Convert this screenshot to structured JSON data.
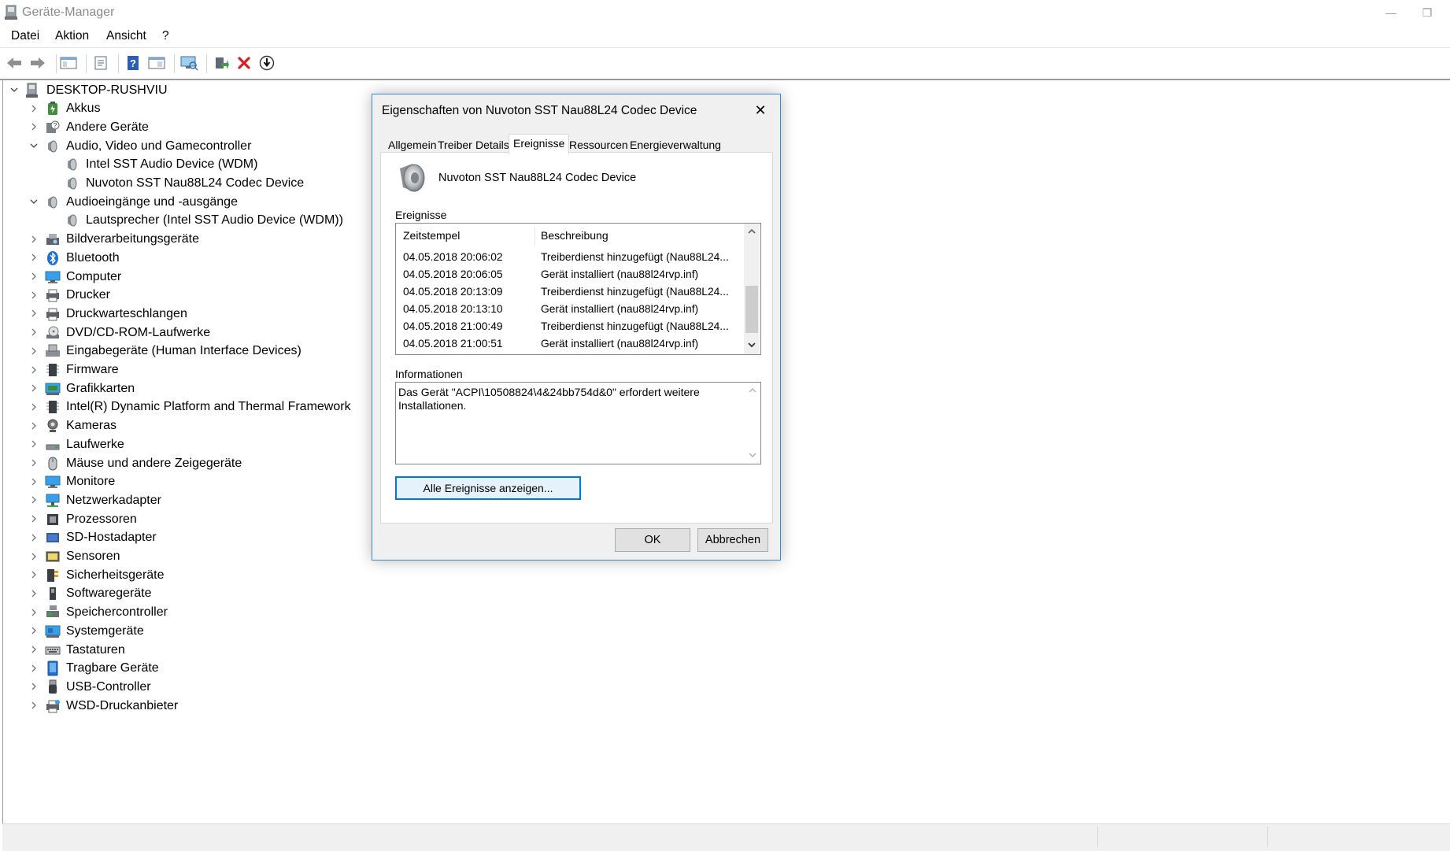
{
  "window": {
    "title": "Geräte-Manager",
    "minimize_glyph": "—",
    "restore_glyph": "❐"
  },
  "menu": [
    "Datei",
    "Aktion",
    "Ansicht",
    "?"
  ],
  "toolbar": {
    "icons": [
      "back-arrow-icon",
      "forward-arrow-icon",
      "show-hide-console-tree-icon",
      "properties-icon",
      "help-icon",
      "action-pane-icon",
      "scan-hardware-icon",
      "update-driver-icon",
      "uninstall-device-icon",
      "disable-device-icon"
    ]
  },
  "tree": {
    "root": "DESKTOP-RUSHVIU",
    "items": [
      {
        "label": "Akkus",
        "expanded": false
      },
      {
        "label": "Andere Geräte",
        "expanded": false
      },
      {
        "label": "Audio, Video und Gamecontroller",
        "expanded": true,
        "children": [
          "Intel SST Audio Device (WDM)",
          "Nuvoton SST Nau88L24 Codec Device"
        ]
      },
      {
        "label": "Audioeingänge und -ausgänge",
        "expanded": true,
        "children": [
          "Lautsprecher (Intel SST Audio Device (WDM))"
        ]
      },
      {
        "label": "Bildverarbeitungsgeräte",
        "expanded": false
      },
      {
        "label": "Bluetooth",
        "expanded": false
      },
      {
        "label": "Computer",
        "expanded": false
      },
      {
        "label": "Drucker",
        "expanded": false
      },
      {
        "label": "Druckwarteschlangen",
        "expanded": false
      },
      {
        "label": "DVD/CD-ROM-Laufwerke",
        "expanded": false
      },
      {
        "label": "Eingabegeräte (Human Interface Devices)",
        "expanded": false
      },
      {
        "label": "Firmware",
        "expanded": false
      },
      {
        "label": "Grafikkarten",
        "expanded": false
      },
      {
        "label": "Intel(R) Dynamic Platform and Thermal Framework",
        "expanded": false
      },
      {
        "label": "Kameras",
        "expanded": false
      },
      {
        "label": "Laufwerke",
        "expanded": false
      },
      {
        "label": "Mäuse und andere Zeigegeräte",
        "expanded": false
      },
      {
        "label": "Monitore",
        "expanded": false
      },
      {
        "label": "Netzwerkadapter",
        "expanded": false
      },
      {
        "label": "Prozessoren",
        "expanded": false
      },
      {
        "label": "SD-Hostadapter",
        "expanded": false
      },
      {
        "label": "Sensoren",
        "expanded": false
      },
      {
        "label": "Sicherheitsgeräte",
        "expanded": false
      },
      {
        "label": "Softwaregeräte",
        "expanded": false
      },
      {
        "label": "Speichercontroller",
        "expanded": false
      },
      {
        "label": "Systemgeräte",
        "expanded": false
      },
      {
        "label": "Tastaturen",
        "expanded": false
      },
      {
        "label": "Tragbare Geräte",
        "expanded": false
      },
      {
        "label": "USB-Controller",
        "expanded": false
      },
      {
        "label": "WSD-Druckanbieter",
        "expanded": false
      }
    ]
  },
  "dialog": {
    "title": "Eigenschaften von Nuvoton SST Nau88L24 Codec Device",
    "tabs": [
      "Allgemein",
      "Treiber",
      "Details",
      "Ereignisse",
      "Ressourcen",
      "Energieverwaltung"
    ],
    "active_tab": "Ereignisse",
    "device_name": "Nuvoton SST Nau88L24 Codec Device",
    "events_label": "Ereignisse",
    "columns": {
      "timestamp": "Zeitstempel",
      "description": "Beschreibung"
    },
    "events": [
      {
        "timestamp": "04.05.2018 20:06:02",
        "description": "Treiberdienst hinzugefügt (Nau88L24..."
      },
      {
        "timestamp": "04.05.2018 20:06:05",
        "description": "Gerät installiert (nau88l24rvp.inf)"
      },
      {
        "timestamp": "04.05.2018 20:13:09",
        "description": "Treiberdienst hinzugefügt (Nau88L24..."
      },
      {
        "timestamp": "04.05.2018 20:13:10",
        "description": "Gerät installiert (nau88l24rvp.inf)"
      },
      {
        "timestamp": "04.05.2018 21:00:49",
        "description": "Treiberdienst hinzugefügt (Nau88L24..."
      },
      {
        "timestamp": "04.05.2018 21:00:51",
        "description": "Gerät installiert (nau88l24rvp.inf)"
      }
    ],
    "info_label": "Informationen",
    "info_text": "Das Gerät \"ACPI\\10508824\\4&24bb754d&0\" erfordert weitere Installationen.",
    "all_events_button": "Alle Ereignisse anzeigen...",
    "ok_button": "OK",
    "cancel_button": "Abbrechen",
    "close_glyph": "✕"
  }
}
